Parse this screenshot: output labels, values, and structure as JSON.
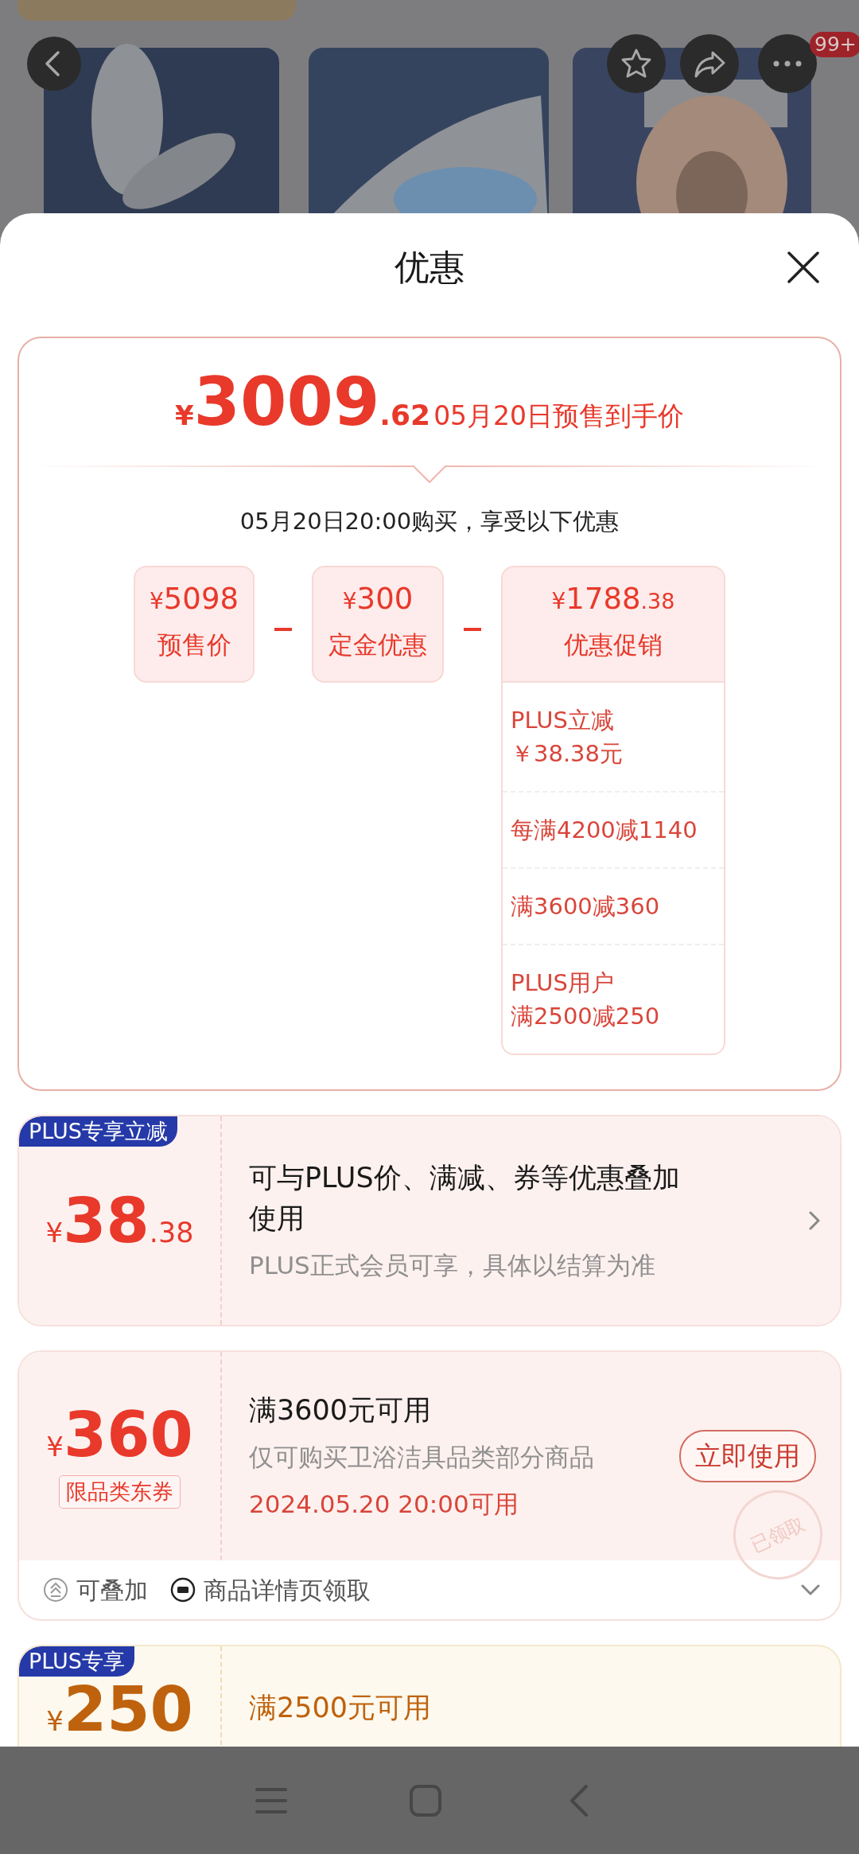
{
  "top_bar": {
    "badge": "99+"
  },
  "sheet": {
    "title": "优惠"
  },
  "summary": {
    "currency": "¥",
    "price": "3009",
    "price_decimal": ".62",
    "price_label": "05月20日预售到手价",
    "subtitle": "05月20日20:00购买，享受以下优惠",
    "terms": [
      {
        "currency": "¥",
        "amount": "5098",
        "label": "预售价"
      },
      {
        "currency": "¥",
        "amount": "300",
        "label": "定金优惠"
      },
      {
        "currency": "¥",
        "amount": "1788",
        "decimal": ".38",
        "label": "优惠促销",
        "details": [
          {
            "lines": [
              "PLUS立减",
              "￥38.38元"
            ]
          },
          {
            "lines": [
              "每满4200减1140"
            ]
          },
          {
            "lines": [
              "满3600减360"
            ]
          },
          {
            "lines": [
              "PLUS用户",
              "满2500减250"
            ]
          }
        ]
      }
    ]
  },
  "coupons": [
    {
      "kind": "red",
      "tag": "PLUS专享立减",
      "currency": "¥",
      "amount": "38",
      "decimal": ".38",
      "title": "可与PLUS价、满减、券等优惠叠加使用",
      "note": "PLUS正式会员可享，具体以结算为准",
      "action": {
        "kind": "chevron"
      }
    },
    {
      "kind": "red",
      "currency": "¥",
      "amount": "360",
      "scope": "限品类东券",
      "title": "满3600元可用",
      "note": "仅可购买卫浴洁具品类部分商品",
      "date": "2024.05.20 20:00可用",
      "action": {
        "kind": "button",
        "label": "立即使用"
      },
      "stamp": "已领取",
      "footer": {
        "expanded": false,
        "items": [
          {
            "kind": "stackable",
            "text": "可叠加"
          },
          {
            "kind": "source",
            "text": "商品详情页领取"
          }
        ]
      }
    },
    {
      "kind": "gold",
      "tag": "PLUS专享",
      "currency": "¥",
      "amount": "250",
      "title": "满2500元可用"
    }
  ]
}
